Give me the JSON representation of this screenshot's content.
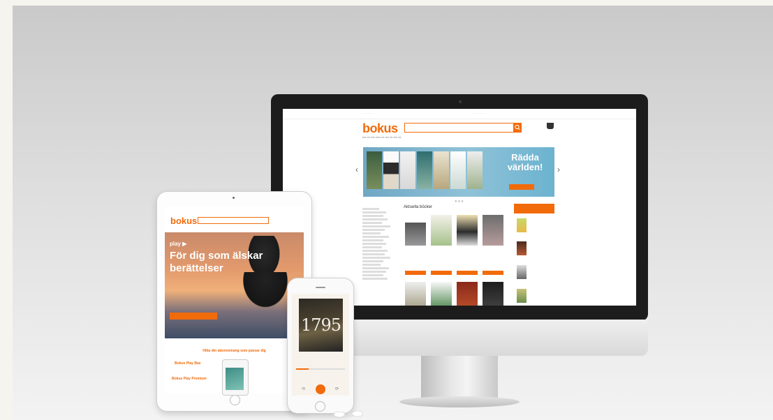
{
  "desktop": {
    "brand": "bokus",
    "hero_title_1": "Rädda",
    "hero_title_2": "världen!",
    "section_title": "Aktuella böcker"
  },
  "tablet": {
    "brand": "bokus",
    "service": "play",
    "hero_title": "För dig som älskar berättelser",
    "plans_heading": "Hitta din abonnemang som passar dig",
    "plan_1": "Bokus Play Bas",
    "plan_2": "Bokus Play Premium"
  },
  "phone": {
    "cover_title": "1795"
  },
  "colors": {
    "brand_orange": "#f26b0a",
    "bezel": "#1c1c1c"
  },
  "icons": [
    "cart-icon",
    "search-icon",
    "play-icon",
    "chevron-left-icon",
    "chevron-right-icon"
  ]
}
